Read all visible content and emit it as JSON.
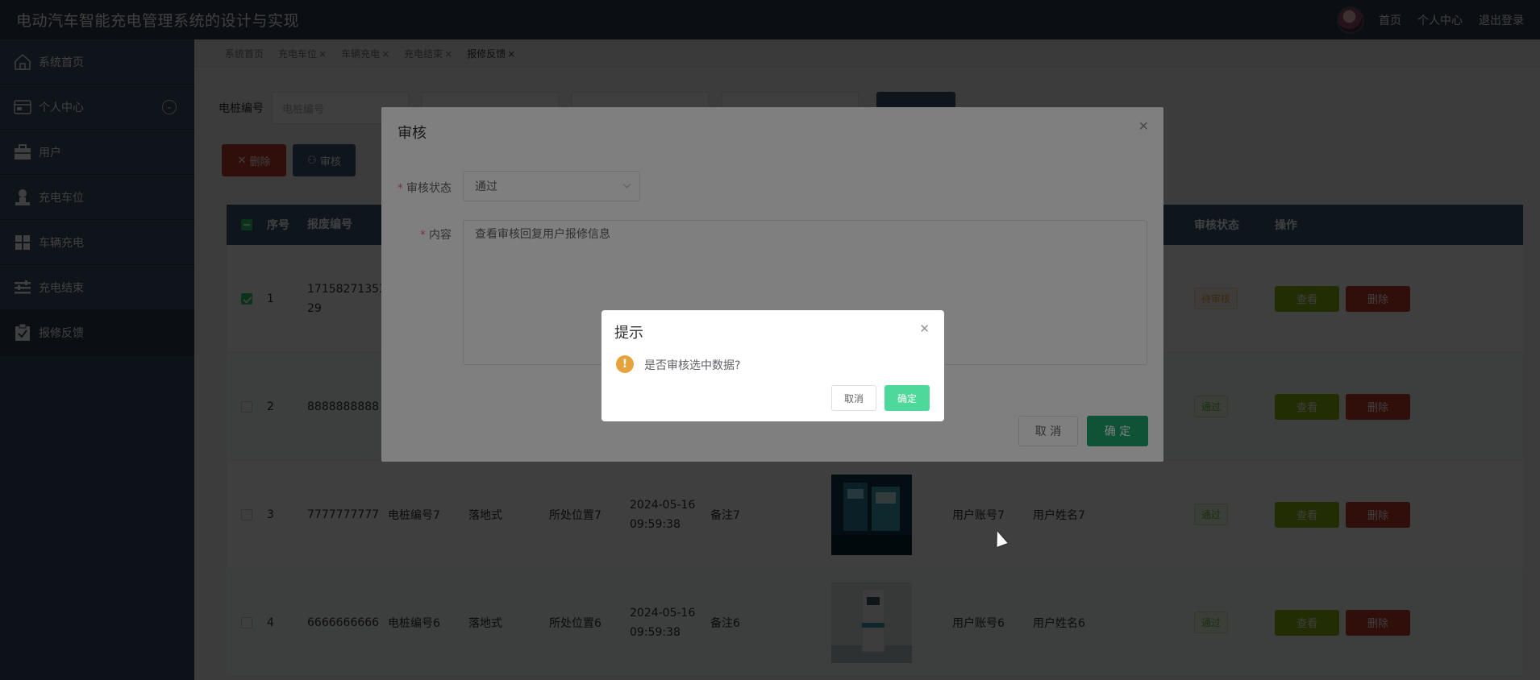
{
  "app": {
    "title": "电动汽车智能充电管理系统的设计与实现"
  },
  "header": {
    "links": [
      "首页",
      "个人中心",
      "退出登录"
    ]
  },
  "sidebar": {
    "items": [
      {
        "label": "系统首页",
        "icon": "home-icon"
      },
      {
        "label": "个人中心",
        "icon": "profile-card-icon"
      },
      {
        "label": "用户",
        "icon": "briefcase-icon"
      },
      {
        "label": "充电车位",
        "icon": "person-stamp-icon"
      },
      {
        "label": "车辆充电",
        "icon": "grid-icon"
      },
      {
        "label": "充电结束",
        "icon": "sliders-icon"
      },
      {
        "label": "报修反馈",
        "icon": "clipboard-check-icon"
      }
    ]
  },
  "tabs": [
    "系统首页",
    "充电车位",
    "车辆充电",
    "充电结束",
    "报修反馈"
  ],
  "search": {
    "label": "电桩编号",
    "placeholder": "电桩编号"
  },
  "actions": {
    "delete": "删除",
    "audit": "审核"
  },
  "table": {
    "headers": {
      "no": "序号",
      "code": "报废编号",
      "status": "审核状态",
      "ops": "操作"
    },
    "rows": [
      {
        "no": "1",
        "code": "1715827135329",
        "pile": "",
        "type": "",
        "loc": "",
        "time": "",
        "remark": "",
        "acct": "",
        "name": "",
        "status": "待审核",
        "checked": true
      },
      {
        "no": "2",
        "code": "8888888888",
        "pile": "",
        "type": "",
        "loc": "",
        "time": "",
        "remark": "",
        "acct": "",
        "name": "",
        "status": "通过",
        "checked": false
      },
      {
        "no": "3",
        "code": "7777777777",
        "pile": "电桩编号7",
        "type": "落地式",
        "loc": "所处位置7",
        "time": "2024-05-16 09:59:38",
        "remark": "备注7",
        "acct": "用户账号7",
        "name": "用户姓名7",
        "status": "通过",
        "checked": false
      },
      {
        "no": "4",
        "code": "6666666666",
        "pile": "电桩编号6",
        "type": "落地式",
        "loc": "所处位置6",
        "time": "2024-05-16 09:59:38",
        "remark": "备注6",
        "acct": "用户账号6",
        "name": "用户姓名6",
        "status": "通过",
        "checked": false
      }
    ],
    "view_label": "查看",
    "delete_label": "删除"
  },
  "audit_dialog": {
    "title": "审核",
    "status_label": "审核状态",
    "status_value": "通过",
    "content_label": "内容",
    "content_value": "查看审核回复用户报修信息",
    "cancel": "取 消",
    "ok": "确 定"
  },
  "confirm_box": {
    "title": "提示",
    "message": "是否审核选中数据?",
    "cancel": "取消",
    "ok": "确定"
  },
  "colors": {
    "header_bg": "#2c3e50",
    "sidebar_bg": "#33495f",
    "accent_green": "#1ca66a",
    "danger": "#c0392b",
    "view_green": "#8bb513"
  }
}
